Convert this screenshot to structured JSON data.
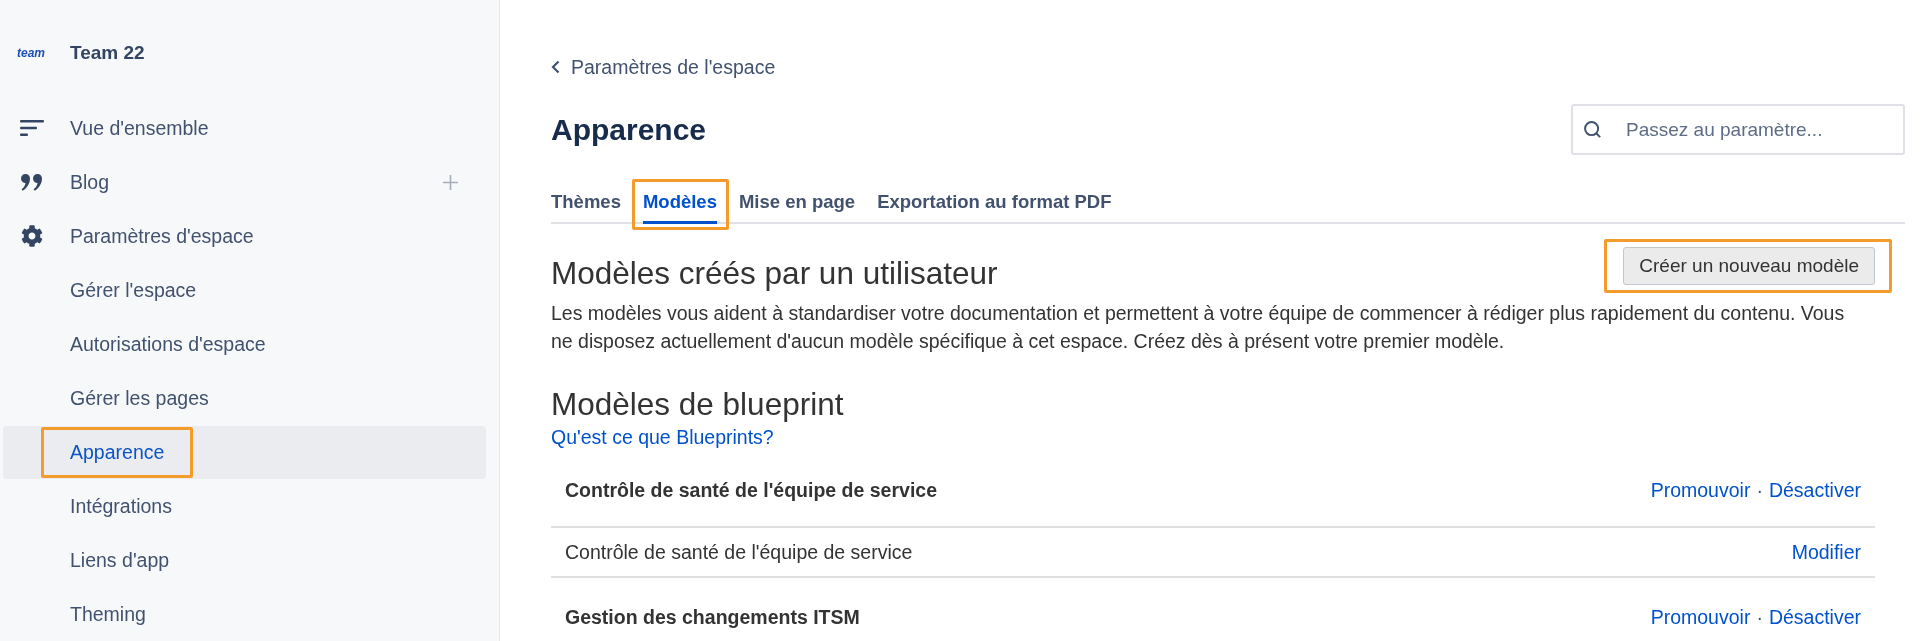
{
  "sidebar": {
    "logo": "team",
    "space_name": "Team 22",
    "nav": [
      {
        "kind": "overview",
        "label": "Vue d'ensemble",
        "selected": false
      },
      {
        "kind": "blog",
        "label": "Blog",
        "selected": false
      },
      {
        "kind": "settings",
        "label": "Paramètres d'espace",
        "selected": false,
        "children": [
          {
            "label": "Gérer l'espace",
            "selected": false,
            "highlighted": false
          },
          {
            "label": "Autorisations d'espace",
            "selected": false,
            "highlighted": false
          },
          {
            "label": "Gérer les pages",
            "selected": false,
            "highlighted": false
          },
          {
            "label": "Apparence",
            "selected": true,
            "highlighted": true
          },
          {
            "label": "Intégrations",
            "selected": false,
            "highlighted": false
          },
          {
            "label": "Liens d'app",
            "selected": false,
            "highlighted": false
          },
          {
            "label": "Theming",
            "selected": false,
            "highlighted": false
          }
        ]
      }
    ]
  },
  "main": {
    "back_link": "Paramètres de l'espace",
    "title": "Apparence",
    "search": {
      "placeholder": "Passez au paramètre..."
    },
    "tabs": [
      {
        "label": "Thèmes",
        "selected": false,
        "highlighted": false
      },
      {
        "label": "Modèles",
        "selected": true,
        "highlighted": true
      },
      {
        "label": "Mise en page",
        "selected": false,
        "highlighted": false
      },
      {
        "label": "Exportation au format PDF",
        "selected": false,
        "highlighted": false
      }
    ],
    "user_templates": {
      "heading": "Modèles créés par un utilisateur",
      "button": {
        "label": "Créer un nouveau modèle",
        "highlighted": true
      },
      "description": "Les modèles vous aident à standardiser votre documentation et permettent à votre équipe de commencer à rédiger plus rapidement du contenu. Vous ne disposez actuellement d'aucun modèle spécifique à cet espace. Créez dès à présent votre premier modèle."
    },
    "blueprints": {
      "heading": "Modèles de blueprint",
      "help_link": "Qu'est ce que Blueprints?",
      "rows": [
        {
          "kind": "group",
          "name": "Contrôle de santé de l'équipe de service",
          "actions": [
            "Promouvoir",
            "Désactiver"
          ],
          "separator": "·"
        },
        {
          "kind": "template",
          "name": "Contrôle de santé de l'équipe de service",
          "actions": [
            "Modifier"
          ]
        },
        {
          "kind": "group",
          "name": "Gestion des changements ITSM",
          "actions": [
            "Promouvoir",
            "Désactiver"
          ],
          "separator": "·"
        }
      ]
    }
  }
}
